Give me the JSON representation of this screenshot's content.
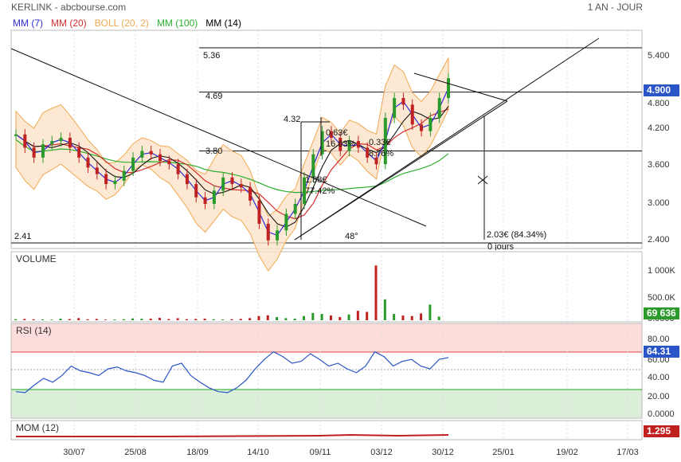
{
  "header": {
    "title": "KERLINK - abcbourse.com",
    "period": "1 AN - JOUR"
  },
  "legend": [
    {
      "label": "MM (7)",
      "color": "#2d2dd6"
    },
    {
      "label": "MM (20)",
      "color": "#d62d2d"
    },
    {
      "label": "BOLL (20, 2)",
      "color": "#f0a850"
    },
    {
      "label": "MM (100)",
      "color": "#2cae2c"
    },
    {
      "label": "MM (14)",
      "color": "#000000"
    }
  ],
  "price_panel": {
    "y_ticks": [
      "5.400",
      "4.800",
      "4.200",
      "3.600",
      "3.000",
      "2.400"
    ],
    "last_value": "4.900",
    "last_value_color": "#2a55c8",
    "horizontal_levels": [
      {
        "label": "5.36",
        "value": 5.36
      },
      {
        "label": "4.69",
        "value": 4.69
      },
      {
        "label": "3.80",
        "value": 3.8
      },
      {
        "label": "2.41",
        "value": 2.41
      }
    ],
    "annotations": {
      "level_432": "4.32",
      "gain1_abs": "1.88€",
      "gain1_pct": "77.42%",
      "gain2_abs": "0.63€",
      "gain2_pct": "16.63%",
      "gain3_abs": "0.33€",
      "gain3_pct": "8.76%",
      "angle": "48°",
      "gain4": "2.03€ (84.34%)",
      "days": "0 jours"
    }
  },
  "volume_panel": {
    "title": "VOLUME",
    "y_ticks": [
      "1 000K",
      "500.0K",
      "0.0000"
    ],
    "last_value": "69 636",
    "last_value_color": "#2a9a2a"
  },
  "rsi_panel": {
    "title": "RSI (14)",
    "y_ticks": [
      "80.00",
      "60.00",
      "40.00",
      "20.00",
      "0.0000"
    ],
    "last_value": "64.31",
    "last_value_color": "#2a55c8"
  },
  "mom_panel": {
    "title": "MOM (12)",
    "last_value": "1.295",
    "last_value_color": "#c02020"
  },
  "x_labels": [
    "30/07",
    "25/08",
    "18/09",
    "14/10",
    "09/11",
    "03/12",
    "30/12",
    "25/01",
    "19/02",
    "17/03"
  ],
  "chart_data": {
    "type": "line",
    "title": "KERLINK",
    "x_labels": [
      "30/07",
      "25/08",
      "18/09",
      "14/10",
      "09/11",
      "03/12",
      "30/12",
      "25/01",
      "19/02",
      "17/03"
    ],
    "close": [
      4.05,
      3.85,
      3.7,
      3.9,
      3.95,
      4.0,
      3.85,
      3.7,
      3.55,
      3.45,
      3.3,
      3.35,
      3.5,
      3.7,
      3.8,
      3.75,
      3.65,
      3.6,
      3.45,
      3.3,
      3.1,
      3.0,
      3.2,
      3.4,
      3.3,
      3.25,
      3.05,
      2.7,
      2.45,
      2.6,
      2.85,
      3.0,
      3.4,
      3.75,
      4.1,
      4.0,
      3.8,
      3.95,
      3.85,
      3.7,
      3.6,
      4.3,
      4.6,
      4.5,
      4.2,
      4.1,
      4.3,
      4.6,
      4.9
    ],
    "ylim": [
      2.35,
      5.6
    ],
    "rsi": [
      28,
      27,
      35,
      42,
      38,
      45,
      55,
      50,
      48,
      45,
      52,
      54,
      50,
      48,
      45,
      40,
      38,
      55,
      58,
      45,
      38,
      32,
      28,
      27,
      32,
      40,
      52,
      62,
      70,
      65,
      58,
      60,
      68,
      62,
      55,
      58,
      52,
      48,
      55,
      70,
      65,
      55,
      60,
      62,
      55,
      52,
      62,
      64
    ],
    "rsi_ylim": [
      0,
      100
    ],
    "volume": [
      20,
      25,
      18,
      15,
      12,
      30,
      22,
      40,
      18,
      25,
      12,
      15,
      20,
      35,
      28,
      30,
      45,
      22,
      38,
      20,
      25,
      30,
      18,
      15,
      20,
      25,
      40,
      80,
      95,
      60,
      40,
      30,
      80,
      140,
      120,
      90,
      60,
      110,
      180,
      160,
      1050,
      400,
      120,
      90,
      80,
      130,
      300,
      70
    ],
    "volume_ylim": [
      0,
      1100
    ],
    "indicators": [
      "MM (7)",
      "MM (20)",
      "BOLL (20, 2)",
      "MM (100)",
      "MM (14)"
    ]
  }
}
